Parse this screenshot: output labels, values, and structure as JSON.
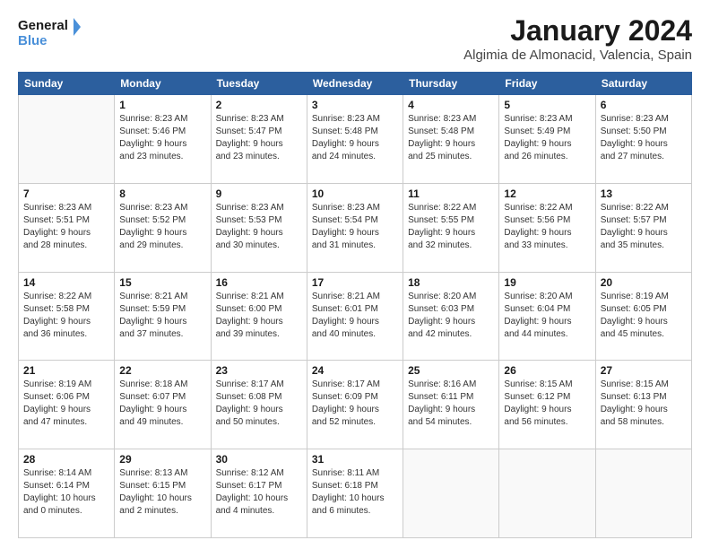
{
  "logo": {
    "line1": "General",
    "line2": "Blue"
  },
  "header": {
    "title": "January 2024",
    "location": "Algimia de Almonacid, Valencia, Spain"
  },
  "days_of_week": [
    "Sunday",
    "Monday",
    "Tuesday",
    "Wednesday",
    "Thursday",
    "Friday",
    "Saturday"
  ],
  "weeks": [
    [
      {
        "day": "",
        "info": ""
      },
      {
        "day": "1",
        "info": "Sunrise: 8:23 AM\nSunset: 5:46 PM\nDaylight: 9 hours\nand 23 minutes."
      },
      {
        "day": "2",
        "info": "Sunrise: 8:23 AM\nSunset: 5:47 PM\nDaylight: 9 hours\nand 23 minutes."
      },
      {
        "day": "3",
        "info": "Sunrise: 8:23 AM\nSunset: 5:48 PM\nDaylight: 9 hours\nand 24 minutes."
      },
      {
        "day": "4",
        "info": "Sunrise: 8:23 AM\nSunset: 5:48 PM\nDaylight: 9 hours\nand 25 minutes."
      },
      {
        "day": "5",
        "info": "Sunrise: 8:23 AM\nSunset: 5:49 PM\nDaylight: 9 hours\nand 26 minutes."
      },
      {
        "day": "6",
        "info": "Sunrise: 8:23 AM\nSunset: 5:50 PM\nDaylight: 9 hours\nand 27 minutes."
      }
    ],
    [
      {
        "day": "7",
        "info": ""
      },
      {
        "day": "8",
        "info": "Sunrise: 8:23 AM\nSunset: 5:52 PM\nDaylight: 9 hours\nand 29 minutes."
      },
      {
        "day": "9",
        "info": "Sunrise: 8:23 AM\nSunset: 5:53 PM\nDaylight: 9 hours\nand 30 minutes."
      },
      {
        "day": "10",
        "info": "Sunrise: 8:23 AM\nSunset: 5:54 PM\nDaylight: 9 hours\nand 31 minutes."
      },
      {
        "day": "11",
        "info": "Sunrise: 8:22 AM\nSunset: 5:55 PM\nDaylight: 9 hours\nand 32 minutes."
      },
      {
        "day": "12",
        "info": "Sunrise: 8:22 AM\nSunset: 5:56 PM\nDaylight: 9 hours\nand 33 minutes."
      },
      {
        "day": "13",
        "info": "Sunrise: 8:22 AM\nSunset: 5:57 PM\nDaylight: 9 hours\nand 35 minutes."
      }
    ],
    [
      {
        "day": "14",
        "info": ""
      },
      {
        "day": "15",
        "info": "Sunrise: 8:21 AM\nSunset: 5:59 PM\nDaylight: 9 hours\nand 37 minutes."
      },
      {
        "day": "16",
        "info": "Sunrise: 8:21 AM\nSunset: 6:00 PM\nDaylight: 9 hours\nand 39 minutes."
      },
      {
        "day": "17",
        "info": "Sunrise: 8:21 AM\nSunset: 6:01 PM\nDaylight: 9 hours\nand 40 minutes."
      },
      {
        "day": "18",
        "info": "Sunrise: 8:20 AM\nSunset: 6:03 PM\nDaylight: 9 hours\nand 42 minutes."
      },
      {
        "day": "19",
        "info": "Sunrise: 8:20 AM\nSunset: 6:04 PM\nDaylight: 9 hours\nand 44 minutes."
      },
      {
        "day": "20",
        "info": "Sunrise: 8:19 AM\nSunset: 6:05 PM\nDaylight: 9 hours\nand 45 minutes."
      }
    ],
    [
      {
        "day": "21",
        "info": "Sunrise: 8:19 AM\nSunset: 6:06 PM\nDaylight: 9 hours\nand 47 minutes."
      },
      {
        "day": "22",
        "info": "Sunrise: 8:18 AM\nSunset: 6:07 PM\nDaylight: 9 hours\nand 49 minutes."
      },
      {
        "day": "23",
        "info": "Sunrise: 8:17 AM\nSunset: 6:08 PM\nDaylight: 9 hours\nand 50 minutes."
      },
      {
        "day": "24",
        "info": "Sunrise: 8:17 AM\nSunset: 6:09 PM\nDaylight: 9 hours\nand 52 minutes."
      },
      {
        "day": "25",
        "info": "Sunrise: 8:16 AM\nSunset: 6:11 PM\nDaylight: 9 hours\nand 54 minutes."
      },
      {
        "day": "26",
        "info": "Sunrise: 8:15 AM\nSunset: 6:12 PM\nDaylight: 9 hours\nand 56 minutes."
      },
      {
        "day": "27",
        "info": "Sunrise: 8:15 AM\nSunset: 6:13 PM\nDaylight: 9 hours\nand 58 minutes."
      }
    ],
    [
      {
        "day": "28",
        "info": "Sunrise: 8:14 AM\nSunset: 6:14 PM\nDaylight: 10 hours\nand 0 minutes."
      },
      {
        "day": "29",
        "info": "Sunrise: 8:13 AM\nSunset: 6:15 PM\nDaylight: 10 hours\nand 2 minutes."
      },
      {
        "day": "30",
        "info": "Sunrise: 8:12 AM\nSunset: 6:17 PM\nDaylight: 10 hours\nand 4 minutes."
      },
      {
        "day": "31",
        "info": "Sunrise: 8:11 AM\nSunset: 6:18 PM\nDaylight: 10 hours\nand 6 minutes."
      },
      {
        "day": "",
        "info": ""
      },
      {
        "day": "",
        "info": ""
      },
      {
        "day": "",
        "info": ""
      }
    ]
  ],
  "week7_row0": {
    "sunday_info": "Sunrise: 8:23 AM\nSunset: 5:51 PM\nDaylight: 9 hours\nand 28 minutes."
  },
  "week14_info": "Sunrise: 8:22 AM\nSunset: 5:58 PM\nDaylight: 9 hours\nand 36 minutes."
}
